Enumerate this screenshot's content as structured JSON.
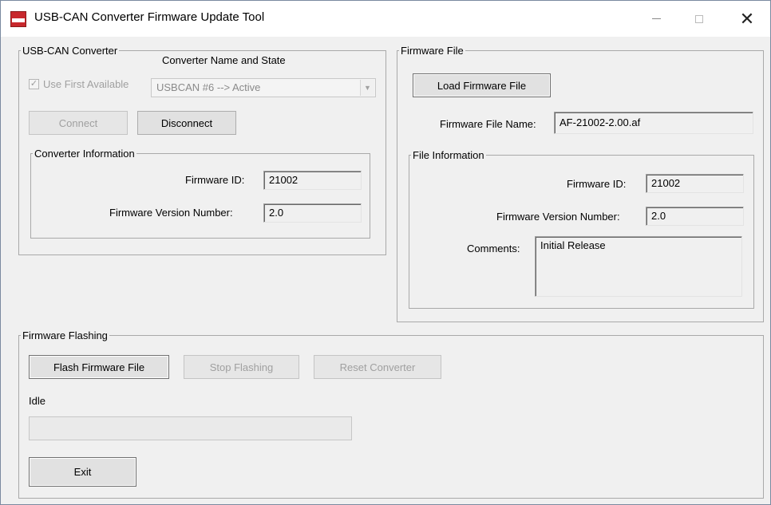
{
  "window": {
    "title": "USB-CAN Converter Firmware Update Tool",
    "minimize_glyph": "",
    "close_glyph": "✕"
  },
  "converter": {
    "group_label": "USB-CAN Converter",
    "header_label": "Converter Name and State",
    "use_first_label": "Use First Available",
    "use_first_checked": true,
    "selected_converter": "USBCAN #6  --> Active",
    "connect_label": "Connect",
    "disconnect_label": "Disconnect",
    "info": {
      "group_label": "Converter Information",
      "firmware_id_label": "Firmware ID:",
      "firmware_id_value": "21002",
      "firmware_version_label": "Firmware Version Number:",
      "firmware_version_value": "2.0"
    }
  },
  "firmware_file": {
    "group_label": "Firmware File",
    "load_button_label": "Load Firmware File",
    "file_name_label": "Firmware File Name:",
    "file_name_value": "AF-21002-2.00.af",
    "info": {
      "group_label": "File Information",
      "firmware_id_label": "Firmware ID:",
      "firmware_id_value": "21002",
      "firmware_version_label": "Firmware Version Number:",
      "firmware_version_value": "2.0",
      "comments_label": "Comments:",
      "comments_value": "Initial Release"
    }
  },
  "flashing": {
    "group_label": "Firmware Flashing",
    "flash_button_label": "Flash Firmware File",
    "stop_button_label": "Stop Flashing",
    "reset_button_label": "Reset Converter",
    "status_text": "Idle",
    "progress_fraction": 0,
    "exit_button_label": "Exit"
  },
  "icons": {
    "app_icon": "usb-can-app-icon",
    "dropdown_icon": "chevron-down-icon",
    "check_icon": "checkmark-icon"
  },
  "colors": {
    "progress_fill": "#06b025",
    "window_background": "#f0f0f0"
  }
}
